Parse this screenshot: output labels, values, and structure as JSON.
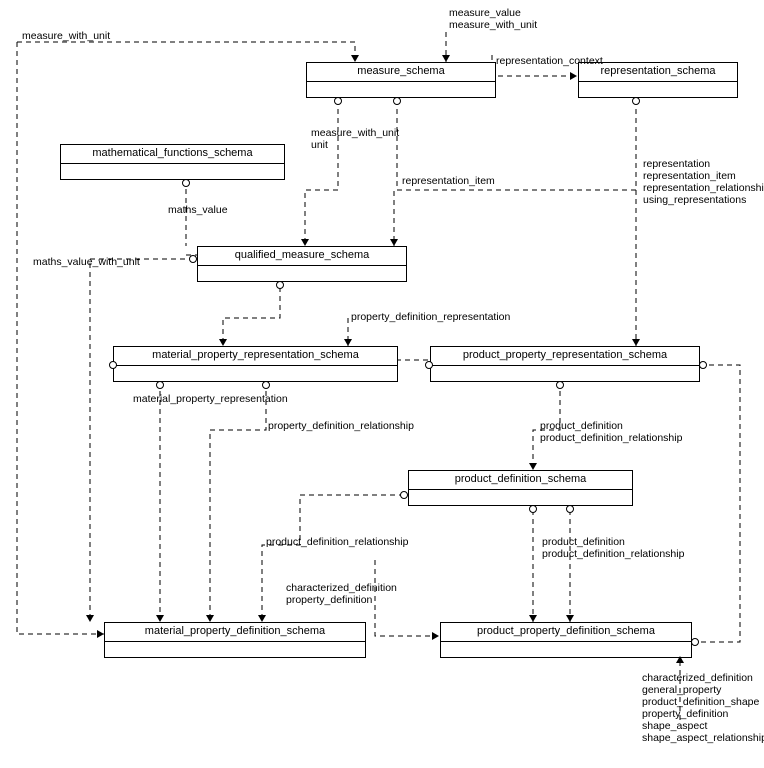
{
  "nodes": {
    "measure_schema": "measure_schema",
    "representation_schema": "representation_schema",
    "mathematical_functions_schema": "mathematical_functions_schema",
    "qualified_measure_schema": "qualified_measure_schema",
    "material_property_representation_schema": "material_property_representation_schema",
    "product_property_representation_schema": "product_property_representation_schema",
    "product_definition_schema": "product_definition_schema",
    "material_property_definition_schema": "material_property_definition_schema",
    "product_property_definition_schema": "product_property_definition_schema"
  },
  "labels": {
    "top_measure": "measure_value\nmeasure_with_unit",
    "top_left": "measure_with_unit",
    "top_repctx": "representation_context",
    "mwu_unit": "measure_with_unit\nunit",
    "rep_item": "representation_item",
    "reps": "representation\nrepresentation_item\nrepresentation_relationship\nusing_representations",
    "maths_value": "maths_value",
    "maths_vunit": "maths_value_with_unit",
    "pdr": "property_definition_representation",
    "mpr": "material_property_representation",
    "pdrel": "property_definition_relationship",
    "pd_pdr": "product_definition\nproduct_definition_relationship",
    "pdrel2": "product_definition_relationship",
    "pd_pdr2": "product_definition\nproduct_definition_relationship",
    "cd_pd": "characterized_definition\nproperty_definition",
    "cd_list": "characterized_definition\ngeneral_property\nproduct_definition_shape\nproperty_definition\nshape_aspect\nshape_aspect_relationship"
  }
}
